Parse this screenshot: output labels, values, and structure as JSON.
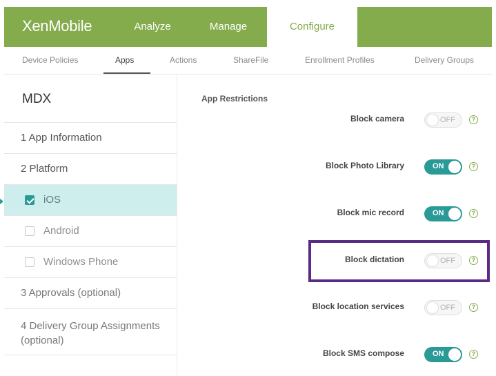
{
  "header": {
    "logo": "XenMobile",
    "tabs": [
      "Analyze",
      "Manage",
      "Configure"
    ],
    "active_tab": "Configure"
  },
  "subnav": {
    "items": [
      "Device Policies",
      "Apps",
      "Actions",
      "ShareFile",
      "Enrollment Profiles",
      "Delivery Groups"
    ],
    "active": "Apps"
  },
  "sidebar": {
    "title": "MDX",
    "steps": [
      {
        "label": "1  App Information"
      },
      {
        "label": "2  Platform"
      },
      {
        "label": "iOS",
        "checked": true,
        "selected": true
      },
      {
        "label": "Android",
        "checked": false
      },
      {
        "label": "Windows Phone",
        "checked": false
      },
      {
        "label": "3  Approvals (optional)"
      },
      {
        "label": "4  Delivery Group Assignments",
        "label2": "(optional)"
      }
    ]
  },
  "main": {
    "section_title": "App Restrictions",
    "options": [
      {
        "label": "Block camera",
        "state": "OFF"
      },
      {
        "label": "Block Photo Library",
        "state": "ON"
      },
      {
        "label": "Block mic record",
        "state": "ON"
      },
      {
        "label": "Block dictation",
        "state": "OFF",
        "highlighted": true
      },
      {
        "label": "Block location services",
        "state": "OFF"
      },
      {
        "label": "Block SMS compose",
        "state": "ON"
      }
    ],
    "help_glyph": "?"
  },
  "colors": {
    "brand": "#84ac4c",
    "toggle_on": "#2a9a97",
    "selection": "#cdeeed",
    "highlight": "#5b2a84"
  }
}
